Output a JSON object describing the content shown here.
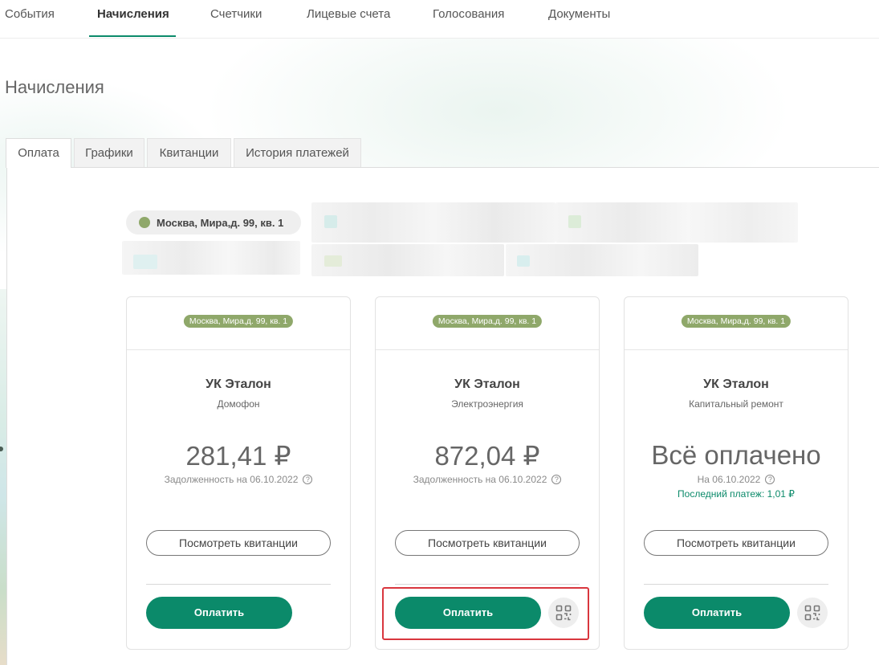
{
  "nav": {
    "items": [
      {
        "label": "События"
      },
      {
        "label": "Начисления",
        "active": true
      },
      {
        "label": "Счетчики"
      },
      {
        "label": "Лицевые счета"
      },
      {
        "label": "Голосования"
      },
      {
        "label": "Документы"
      }
    ]
  },
  "page": {
    "title": "Начисления"
  },
  "tabs": [
    {
      "label": "Оплата",
      "active": true
    },
    {
      "label": "Графики"
    },
    {
      "label": "Квитанции"
    },
    {
      "label": "История платежей"
    }
  ],
  "address_chip": {
    "label": "Москва, Мира,д. 99, кв. 1",
    "dot_color": "#8fa86a"
  },
  "cards": [
    {
      "badge": "Москва, Мира,д. 99, кв. 1",
      "org": "УК Эталон",
      "service": "Домофон",
      "amount": "281,41 ₽",
      "sub": "Задолженность на 06.10.2022",
      "view_label": "Посмотреть квитанции",
      "pay_label": "Оплатить",
      "has_qr": false
    },
    {
      "badge": "Москва, Мира,д. 99, кв. 1",
      "org": "УК Эталон",
      "service": "Электроэнергия",
      "amount": "872,04 ₽",
      "sub": "Задолженность на 06.10.2022",
      "view_label": "Посмотреть квитанции",
      "pay_label": "Оплатить",
      "has_qr": true
    },
    {
      "badge": "Москва, Мира,д. 99, кв. 1",
      "org": "УК Эталон",
      "service": "Капитальный ремонт",
      "amount": "Всё оплачено",
      "sub": "На 06.10.2022",
      "last_payment": "Последний платеж: 1,01 ₽",
      "view_label": "Посмотреть квитанции",
      "pay_label": "Оплатить",
      "has_qr": true
    }
  ],
  "icons": {
    "help": "question-circle-icon",
    "qr": "qr-code-icon",
    "address_dot": "status-dot-icon"
  },
  "colors": {
    "accent": "#0b8a6a",
    "badge": "#8fa86a",
    "highlight": "#d9363e"
  }
}
